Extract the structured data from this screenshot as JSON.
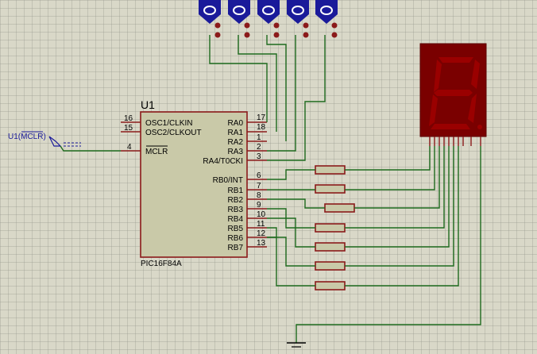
{
  "chip": {
    "ref": "U1",
    "part": "PIC16F84A",
    "left_pins": [
      {
        "num": "16",
        "name": "OSC1/CLKIN"
      },
      {
        "num": "15",
        "name": "OSC2/CLKOUT"
      },
      {
        "num": "4",
        "name": "MCLR"
      }
    ],
    "right_pins": [
      {
        "num": "17",
        "name": "RA0"
      },
      {
        "num": "18",
        "name": "RA1"
      },
      {
        "num": "1",
        "name": "RA2"
      },
      {
        "num": "2",
        "name": "RA3"
      },
      {
        "num": "3",
        "name": "RA4/T0CKI"
      },
      {
        "num": "6",
        "name": "RB0/INT"
      },
      {
        "num": "7",
        "name": "RB1"
      },
      {
        "num": "8",
        "name": "RB2"
      },
      {
        "num": "9",
        "name": "RB3"
      },
      {
        "num": "10",
        "name": "RB4"
      },
      {
        "num": "11",
        "name": "RB5"
      },
      {
        "num": "12",
        "name": "RB6"
      },
      {
        "num": "13",
        "name": "RB7"
      }
    ]
  },
  "mclr_terminal": {
    "label": "U1(MCLR)"
  },
  "switches": {
    "count": 5
  },
  "resistors": {
    "count": 7
  },
  "colors": {
    "wire": "#1e6a1e",
    "lead": "#8b1a1a",
    "chip_fill": "#c9c9a8",
    "switch_fill": "#1a1a9a",
    "display_fill": "#7a0000",
    "label_blue": "#1a1a9a"
  }
}
